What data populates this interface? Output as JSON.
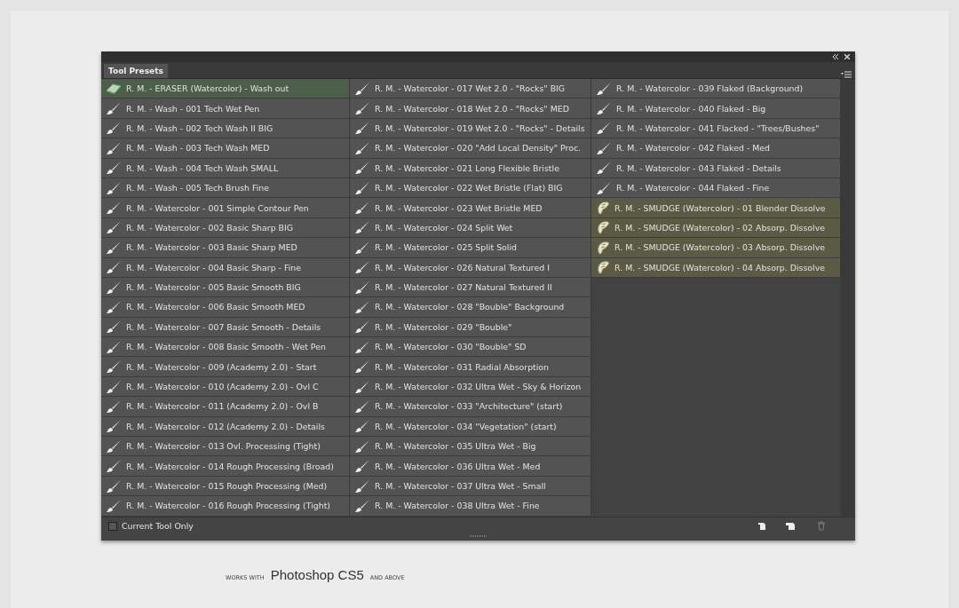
{
  "panel": {
    "tab": {
      "label": "Tool Presets",
      "selected": true
    },
    "presets": [
      {
        "kind": "eraser",
        "label": "R. M. - ERASER (Watercolor) - Wash out"
      },
      {
        "kind": "brush",
        "label": "R. M. - Wash - 001 Tech Wet Pen"
      },
      {
        "kind": "brush",
        "label": "R. M. - Wash - 002 Tech Wash II BIG"
      },
      {
        "kind": "brush",
        "label": "R. M. - Wash - 003 Tech Wash MED"
      },
      {
        "kind": "brush",
        "label": "R. M. - Wash - 004 Tech Wash SMALL"
      },
      {
        "kind": "brush",
        "label": "R. M. - Wash - 005 Tech Brush Fine"
      },
      {
        "kind": "brush",
        "label": "R. M. - Watercolor - 001 Simple Contour Pen"
      },
      {
        "kind": "brush",
        "label": "R. M. - Watercolor - 002 Basic Sharp BIG"
      },
      {
        "kind": "brush",
        "label": "R. M. - Watercolor - 003 Basic Sharp MED"
      },
      {
        "kind": "brush",
        "label": "R. M. - Watercolor - 004 Basic Sharp - Fine"
      },
      {
        "kind": "brush",
        "label": "R. M. - Watercolor - 005 Basic Smooth BIG"
      },
      {
        "kind": "brush",
        "label": "R. M. - Watercolor - 006 Basic Smooth MED"
      },
      {
        "kind": "brush",
        "label": "R. M. - Watercolor - 007 Basic Smooth - Details"
      },
      {
        "kind": "brush",
        "label": "R. M. - Watercolor - 008 Basic Smooth - Wet Pen"
      },
      {
        "kind": "brush",
        "label": "R. M. - Watercolor - 009 (Academy 2.0) - Start"
      },
      {
        "kind": "brush",
        "label": "R. M. - Watercolor - 010 (Academy 2.0) - Ovl C"
      },
      {
        "kind": "brush",
        "label": "R. M. - Watercolor - 011 (Academy 2.0) - Ovl B"
      },
      {
        "kind": "brush",
        "label": "R. M. - Watercolor - 012 (Academy 2.0) - Details"
      },
      {
        "kind": "brush",
        "label": "R. M. - Watercolor - 013 Ovl. Processing (Tight)"
      },
      {
        "kind": "brush",
        "label": "R. M. - Watercolor - 014 Rough Processing (Broad)"
      },
      {
        "kind": "brush",
        "label": "R. M. - Watercolor - 015 Rough Processing (Med)"
      },
      {
        "kind": "brush",
        "label": "R. M. - Watercolor - 016 Rough Processing (Tight)"
      },
      {
        "kind": "brush",
        "label": "R. M. - Watercolor - 017 Wet 2.0 - \"Rocks\" BIG"
      },
      {
        "kind": "brush",
        "label": "R. M. - Watercolor - 018 Wet 2.0 - \"Rocks\" MED"
      },
      {
        "kind": "brush",
        "label": "R. M. - Watercolor - 019 Wet 2.0 - \"Rocks\" - Details"
      },
      {
        "kind": "brush",
        "label": "R. M. - Watercolor - 020 \"Add Local Density\" Proc."
      },
      {
        "kind": "brush",
        "label": "R. M. - Watercolor - 021 Long Flexible Bristle"
      },
      {
        "kind": "brush",
        "label": "R. M. - Watercolor - 022 Wet Bristle (Flat) BIG"
      },
      {
        "kind": "brush",
        "label": "R. M. - Watercolor - 023 Wet Bristle MED"
      },
      {
        "kind": "brush",
        "label": "R. M. - Watercolor - 024 Split Wet"
      },
      {
        "kind": "brush",
        "label": "R. M. - Watercolor - 025 Split Solid"
      },
      {
        "kind": "brush",
        "label": "R. M. - Watercolor - 026 Natural Textured I"
      },
      {
        "kind": "brush",
        "label": "R. M. - Watercolor - 027 Natural Textured II"
      },
      {
        "kind": "brush",
        "label": "R. M. - Watercolor - 028 \"Bouble\" Background"
      },
      {
        "kind": "brush",
        "label": "R. M. - Watercolor - 029 \"Bouble\""
      },
      {
        "kind": "brush",
        "label": "R. M. - Watercolor - 030 \"Bouble\" SD"
      },
      {
        "kind": "brush",
        "label": "R. M. - Watercolor - 031 Radial Absorption"
      },
      {
        "kind": "brush",
        "label": "R. M. - Watercolor - 032 Ultra Wet - Sky & Horizon"
      },
      {
        "kind": "brush",
        "label": "R. M. - Watercolor - 033 \"Architecture\" (start)"
      },
      {
        "kind": "brush",
        "label": "R. M. - Watercolor - 034 \"Vegetation\" (start)"
      },
      {
        "kind": "brush",
        "label": "R. M. - Watercolor - 035 Ultra Wet - Big"
      },
      {
        "kind": "brush",
        "label": "R. M. - Watercolor - 036 Ultra Wet - Med"
      },
      {
        "kind": "brush",
        "label": "R. M. - Watercolor - 037 Ultra Wet - Small"
      },
      {
        "kind": "brush",
        "label": "R. M. - Watercolor - 038 Ultra Wet - Fine"
      },
      {
        "kind": "brush",
        "label": "R. M. - Watercolor - 039 Flaked (Background)"
      },
      {
        "kind": "brush",
        "label": "R. M. - Watercolor - 040 Flaked - Big"
      },
      {
        "kind": "brush",
        "label": "R. M. - Watercolor - 041 Flacked - \"Trees/Bushes\""
      },
      {
        "kind": "brush",
        "label": "R. M. - Watercolor - 042 Flaked - Med"
      },
      {
        "kind": "brush",
        "label": "R. M. - Watercolor - 043 Flaked - Details"
      },
      {
        "kind": "brush",
        "label": "R. M. - Watercolor - 044 Flaked - Fine"
      },
      {
        "kind": "smudge",
        "label": "R. M. - SMUDGE (Watercolor) - 01 Blender Dissolve"
      },
      {
        "kind": "smudge",
        "label": "R. M. - SMUDGE (Watercolor) - 02 Absorp. Dissolve"
      },
      {
        "kind": "smudge",
        "label": "R. M. - SMUDGE (Watercolor) - 03 Absorp. Dissolve"
      },
      {
        "kind": "smudge",
        "label": "R. M. - SMUDGE (Watercolor) - 04 Absorp. Dissolve"
      }
    ],
    "current_tool_only": {
      "label": "Current Tool Only",
      "checked": false
    },
    "delete_disabled": true
  },
  "footer": {
    "prefix": "WORKS WITH",
    "product": "Photoshop CS5",
    "suffix": "AND ABOVE"
  }
}
